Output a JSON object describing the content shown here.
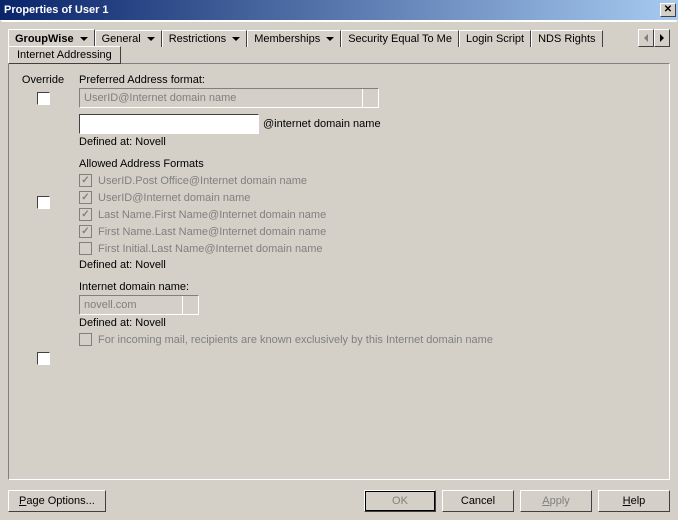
{
  "window": {
    "title": "Properties of User 1"
  },
  "tabs": {
    "main": [
      "GroupWise",
      "General",
      "Restrictions",
      "Memberships",
      "Security Equal To Me",
      "Login Script",
      "NDS Rights"
    ],
    "active": 0,
    "sub": "Internet Addressing"
  },
  "override_header": "Override",
  "preferred": {
    "label": "Preferred Address format:",
    "selected": "UserID@Internet domain name",
    "free_suffix": "@internet domain name",
    "defined": "Defined at:  Novell"
  },
  "allowed": {
    "label": "Allowed Address Formats",
    "options": [
      {
        "label": "UserID.Post Office@Internet domain name",
        "checked": true
      },
      {
        "label": "UserID@Internet domain name",
        "checked": true
      },
      {
        "label": "Last Name.First Name@Internet domain name",
        "checked": true
      },
      {
        "label": "First Name.Last Name@Internet domain name",
        "checked": true
      },
      {
        "label": "First Initial.Last Name@Internet domain name",
        "checked": false
      }
    ],
    "defined": "Defined at:  Novell"
  },
  "domain": {
    "label": "Internet domain name:",
    "selected": "novell.com",
    "defined": "Defined at:  Novell",
    "incoming": "For incoming mail, recipients are known exclusively by this Internet domain name"
  },
  "buttons": {
    "page_options": "Page Options...",
    "ok": "OK",
    "cancel": "Cancel",
    "apply": "Apply",
    "help": "Help"
  }
}
